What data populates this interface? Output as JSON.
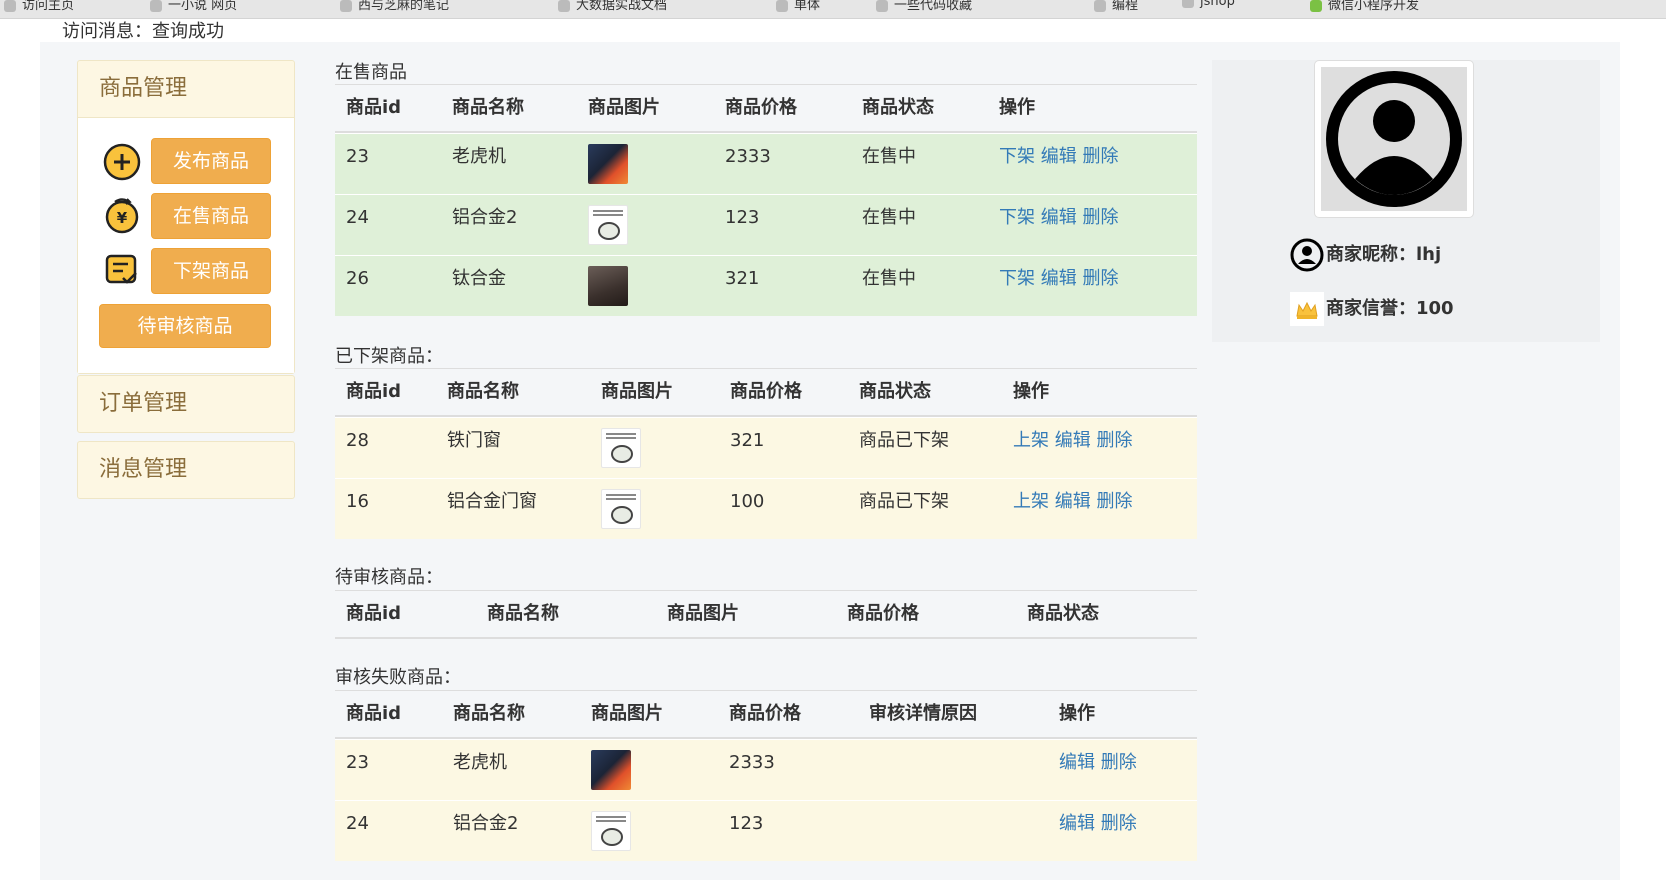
{
  "browser_bookmarks": [
    "访问主页",
    "一小说 网页",
    "西与芝麻的笔记",
    "大数据实战文档",
    "单体",
    "一些代码收藏",
    "编程",
    "jshop",
    "微信小程序开发"
  ],
  "message": "访问消息：查询成功",
  "sidebar": {
    "product_mgmt": "商品管理",
    "buttons": {
      "publish": "发布商品",
      "on_sale": "在售商品",
      "off_shelf": "下架商品",
      "pending": "待审核商品"
    },
    "order_mgmt": "订单管理",
    "message_mgmt": "消息管理"
  },
  "on_sale": {
    "title": "在售商品",
    "headers": [
      "商品id",
      "商品名称",
      "商品图片",
      "商品价格",
      "商品状态",
      "操作"
    ],
    "rows": [
      {
        "id": "23",
        "name": "老虎机",
        "image": "laptop-thumbnail",
        "price": "2333",
        "status": "在售中",
        "a1": "下架",
        "a2": "编辑",
        "a3": "删除"
      },
      {
        "id": "24",
        "name": "铝合金2",
        "image": "meme-thumbnail",
        "price": "123",
        "status": "在售中",
        "a1": "下架",
        "a2": "编辑",
        "a3": "删除"
      },
      {
        "id": "26",
        "name": "钛合金",
        "image": "box-thumbnail",
        "price": "321",
        "status": "在售中",
        "a1": "下架",
        "a2": "编辑",
        "a3": "删除"
      }
    ]
  },
  "off_shelf": {
    "title": "已下架商品：",
    "headers": [
      "商品id",
      "商品名称",
      "商品图片",
      "商品价格",
      "商品状态",
      "操作"
    ],
    "rows": [
      {
        "id": "28",
        "name": "铁门窗",
        "image": "meme-thumbnail",
        "price": "321",
        "status": "商品已下架",
        "a1": "上架",
        "a2": "编辑",
        "a3": "删除"
      },
      {
        "id": "16",
        "name": "铝合金门窗",
        "image": "meme-thumbnail",
        "price": "100",
        "status": "商品已下架",
        "a1": "上架",
        "a2": "编辑",
        "a3": "删除"
      }
    ]
  },
  "pending": {
    "title": "待审核商品：",
    "headers": [
      "商品id",
      "商品名称",
      "商品图片",
      "商品价格",
      "商品状态"
    ]
  },
  "failed": {
    "title": "审核失败商品：",
    "headers": [
      "商品id",
      "商品名称",
      "商品图片",
      "商品价格",
      "审核详情原因",
      "操作"
    ],
    "rows": [
      {
        "id": "23",
        "name": "老虎机",
        "image": "laptop-thumbnail",
        "price": "2333",
        "reason": "",
        "a1": "编辑",
        "a2": "删除"
      },
      {
        "id": "24",
        "name": "铝合金2",
        "image": "meme-thumbnail",
        "price": "123",
        "reason": "",
        "a1": "编辑",
        "a2": "删除"
      }
    ]
  },
  "profile": {
    "nickname_label": "商家昵称：",
    "nickname": "lhj",
    "credit_label": "商家信誉：",
    "credit": "100"
  },
  "colors": {
    "accent": "#f0ad4e",
    "link": "#337ab7",
    "on_sale_row": "#dff0d8",
    "warning_row": "#fcf8e3"
  }
}
